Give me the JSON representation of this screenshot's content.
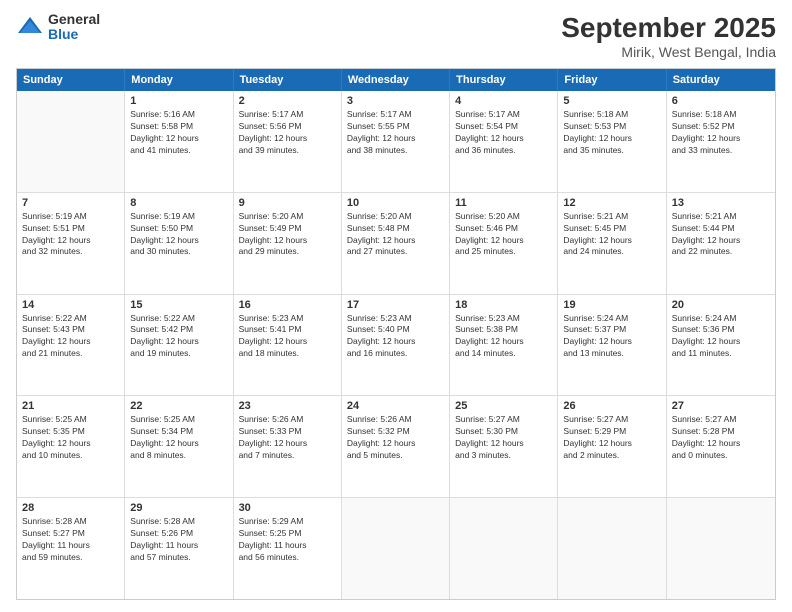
{
  "logo": {
    "general": "General",
    "blue": "Blue"
  },
  "title": "September 2025",
  "subtitle": "Mirik, West Bengal, India",
  "header_days": [
    "Sunday",
    "Monday",
    "Tuesday",
    "Wednesday",
    "Thursday",
    "Friday",
    "Saturday"
  ],
  "weeks": [
    [
      {
        "day": "",
        "info": "",
        "empty": true
      },
      {
        "day": "1",
        "info": "Sunrise: 5:16 AM\nSunset: 5:58 PM\nDaylight: 12 hours\nand 41 minutes."
      },
      {
        "day": "2",
        "info": "Sunrise: 5:17 AM\nSunset: 5:56 PM\nDaylight: 12 hours\nand 39 minutes."
      },
      {
        "day": "3",
        "info": "Sunrise: 5:17 AM\nSunset: 5:55 PM\nDaylight: 12 hours\nand 38 minutes."
      },
      {
        "day": "4",
        "info": "Sunrise: 5:17 AM\nSunset: 5:54 PM\nDaylight: 12 hours\nand 36 minutes."
      },
      {
        "day": "5",
        "info": "Sunrise: 5:18 AM\nSunset: 5:53 PM\nDaylight: 12 hours\nand 35 minutes."
      },
      {
        "day": "6",
        "info": "Sunrise: 5:18 AM\nSunset: 5:52 PM\nDaylight: 12 hours\nand 33 minutes."
      }
    ],
    [
      {
        "day": "7",
        "info": "Sunrise: 5:19 AM\nSunset: 5:51 PM\nDaylight: 12 hours\nand 32 minutes."
      },
      {
        "day": "8",
        "info": "Sunrise: 5:19 AM\nSunset: 5:50 PM\nDaylight: 12 hours\nand 30 minutes."
      },
      {
        "day": "9",
        "info": "Sunrise: 5:20 AM\nSunset: 5:49 PM\nDaylight: 12 hours\nand 29 minutes."
      },
      {
        "day": "10",
        "info": "Sunrise: 5:20 AM\nSunset: 5:48 PM\nDaylight: 12 hours\nand 27 minutes."
      },
      {
        "day": "11",
        "info": "Sunrise: 5:20 AM\nSunset: 5:46 PM\nDaylight: 12 hours\nand 25 minutes."
      },
      {
        "day": "12",
        "info": "Sunrise: 5:21 AM\nSunset: 5:45 PM\nDaylight: 12 hours\nand 24 minutes."
      },
      {
        "day": "13",
        "info": "Sunrise: 5:21 AM\nSunset: 5:44 PM\nDaylight: 12 hours\nand 22 minutes."
      }
    ],
    [
      {
        "day": "14",
        "info": "Sunrise: 5:22 AM\nSunset: 5:43 PM\nDaylight: 12 hours\nand 21 minutes."
      },
      {
        "day": "15",
        "info": "Sunrise: 5:22 AM\nSunset: 5:42 PM\nDaylight: 12 hours\nand 19 minutes."
      },
      {
        "day": "16",
        "info": "Sunrise: 5:23 AM\nSunset: 5:41 PM\nDaylight: 12 hours\nand 18 minutes."
      },
      {
        "day": "17",
        "info": "Sunrise: 5:23 AM\nSunset: 5:40 PM\nDaylight: 12 hours\nand 16 minutes."
      },
      {
        "day": "18",
        "info": "Sunrise: 5:23 AM\nSunset: 5:38 PM\nDaylight: 12 hours\nand 14 minutes."
      },
      {
        "day": "19",
        "info": "Sunrise: 5:24 AM\nSunset: 5:37 PM\nDaylight: 12 hours\nand 13 minutes."
      },
      {
        "day": "20",
        "info": "Sunrise: 5:24 AM\nSunset: 5:36 PM\nDaylight: 12 hours\nand 11 minutes."
      }
    ],
    [
      {
        "day": "21",
        "info": "Sunrise: 5:25 AM\nSunset: 5:35 PM\nDaylight: 12 hours\nand 10 minutes."
      },
      {
        "day": "22",
        "info": "Sunrise: 5:25 AM\nSunset: 5:34 PM\nDaylight: 12 hours\nand 8 minutes."
      },
      {
        "day": "23",
        "info": "Sunrise: 5:26 AM\nSunset: 5:33 PM\nDaylight: 12 hours\nand 7 minutes."
      },
      {
        "day": "24",
        "info": "Sunrise: 5:26 AM\nSunset: 5:32 PM\nDaylight: 12 hours\nand 5 minutes."
      },
      {
        "day": "25",
        "info": "Sunrise: 5:27 AM\nSunset: 5:30 PM\nDaylight: 12 hours\nand 3 minutes."
      },
      {
        "day": "26",
        "info": "Sunrise: 5:27 AM\nSunset: 5:29 PM\nDaylight: 12 hours\nand 2 minutes."
      },
      {
        "day": "27",
        "info": "Sunrise: 5:27 AM\nSunset: 5:28 PM\nDaylight: 12 hours\nand 0 minutes."
      }
    ],
    [
      {
        "day": "28",
        "info": "Sunrise: 5:28 AM\nSunset: 5:27 PM\nDaylight: 11 hours\nand 59 minutes."
      },
      {
        "day": "29",
        "info": "Sunrise: 5:28 AM\nSunset: 5:26 PM\nDaylight: 11 hours\nand 57 minutes."
      },
      {
        "day": "30",
        "info": "Sunrise: 5:29 AM\nSunset: 5:25 PM\nDaylight: 11 hours\nand 56 minutes."
      },
      {
        "day": "",
        "info": "",
        "empty": true
      },
      {
        "day": "",
        "info": "",
        "empty": true
      },
      {
        "day": "",
        "info": "",
        "empty": true
      },
      {
        "day": "",
        "info": "",
        "empty": true
      }
    ]
  ]
}
